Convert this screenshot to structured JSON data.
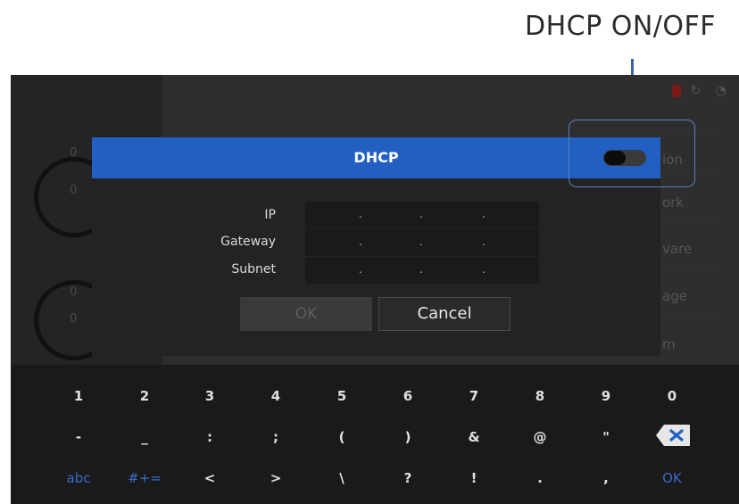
{
  "annotation": {
    "label": "DHCP ON/OFF"
  },
  "dialog": {
    "title": "DHCP",
    "dhcp_toggle": {
      "state": "off"
    },
    "fields": [
      {
        "label": "IP",
        "dots": [
          ".",
          ".",
          "."
        ]
      },
      {
        "label": "Gateway",
        "dots": [
          ".",
          ".",
          "."
        ]
      },
      {
        "label": "Subnet",
        "dots": [
          ".",
          ".",
          "."
        ]
      }
    ],
    "ok_label": "OK",
    "cancel_label": "Cancel"
  },
  "background_menu": {
    "items": [
      "ion",
      "ork",
      "vare",
      "age",
      "m"
    ]
  },
  "background_gauges": [
    {
      "top_value": "0",
      "bottom_value": "0"
    },
    {
      "top_value": "0",
      "bottom_value": "0"
    }
  ],
  "keyboard": {
    "row1": [
      "1",
      "2",
      "3",
      "4",
      "5",
      "6",
      "7",
      "8",
      "9",
      "0"
    ],
    "row2": [
      "-",
      "_",
      ":",
      ";",
      "(",
      ")",
      "&",
      "@",
      "\"",
      "⌫"
    ],
    "row3": [
      "abc",
      "#+=",
      "<",
      ">",
      "\\",
      "?",
      "!",
      ".",
      ",",
      "OK"
    ]
  },
  "colors": {
    "header_blue": "#2160c2",
    "accent_blue": "#3a6ac9",
    "annotation_arrow": "#3f63a8"
  }
}
